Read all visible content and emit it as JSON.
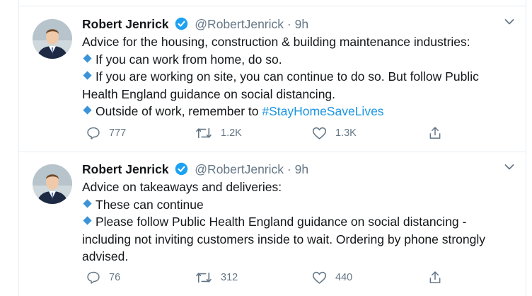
{
  "tweets": [
    {
      "author_name": "Robert Jenrick",
      "handle": "@RobertJenrick",
      "separator": "·",
      "time": "9h",
      "lines": [
        "Advice for the housing, construction & building maintenance industries:",
        "If you can work from home, do so.",
        "If you are working on site, you can continue to do so. But follow Public",
        "Health England guidance on social distancing.",
        "Outside of work, remember to",
        "#StayHomeSaveLives"
      ],
      "replies": "777",
      "retweets": "1.2K",
      "likes": "1.3K"
    },
    {
      "author_name": "Robert Jenrick",
      "handle": "@RobertJenrick",
      "separator": "·",
      "time": "9h",
      "lines": [
        "Advice on takeaways and deliveries:",
        "These can continue",
        "Please follow Public Health England guidance on social distancing -",
        "including not inviting customers inside to wait. Ordering by phone strongly",
        "advised."
      ],
      "replies": "76",
      "retweets": "312",
      "likes": "440"
    }
  ],
  "colors": {
    "text": "#14171a",
    "secondary": "#657786",
    "accent": "#1b95e0",
    "bullet": "#3b94d9",
    "border": "#e6ecf0"
  },
  "icons": [
    "verified-badge-icon",
    "chevron-down-icon",
    "reply-icon",
    "retweet-icon",
    "like-icon",
    "share-icon"
  ]
}
